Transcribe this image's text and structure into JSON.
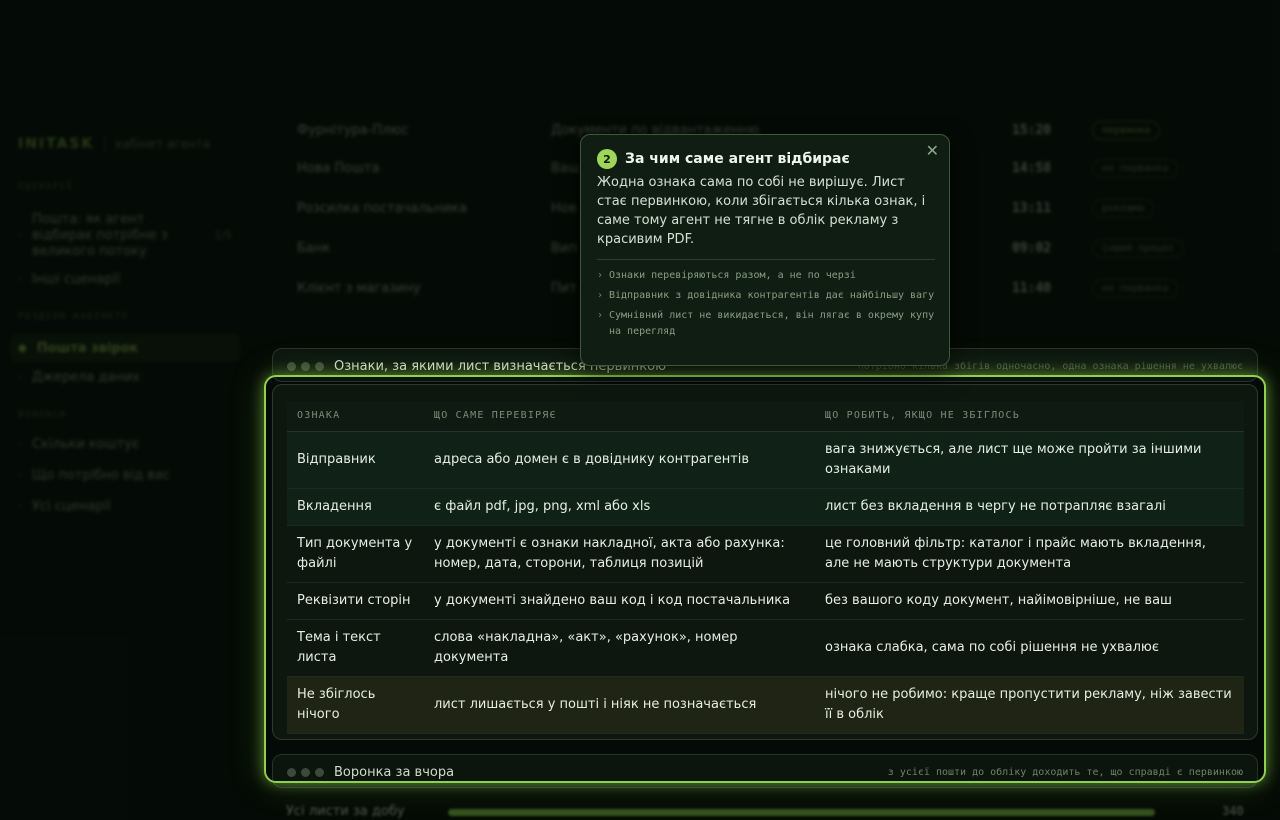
{
  "sidebar": {
    "brand": "INITASK",
    "brand_sub": "кабінет агента",
    "sections": [
      {
        "title": "СЦЕНАРІЇ",
        "items": [
          {
            "label": "Пошта: як агент відбирає потрібне з великого потоку",
            "count": "1/5"
          },
          {
            "label": "Інші сценарії",
            "count": ""
          }
        ]
      },
      {
        "title": "РОЗДІЛИ КАБІНЕТУ",
        "items": [
          {
            "label": "Пошта звірок",
            "count": ""
          },
          {
            "label": "Джерела даних",
            "count": ""
          }
        ]
      },
      {
        "title": "ФІНАНСИ",
        "items": [
          {
            "label": "Скільки коштує",
            "count": ""
          },
          {
            "label": "Що потрібно від вас",
            "count": ""
          },
          {
            "label": "Усі сценарії",
            "count": ""
          }
        ]
      }
    ]
  },
  "mail_rows": [
    {
      "from": "Фурнітура-Плюс",
      "subject": "Документи по відвантаженню",
      "time": "15:20",
      "tag": "первинка"
    },
    {
      "from": "Нова Пошта",
      "subject": "Ваш",
      "time": "14:58",
      "tag": "не первинка"
    },
    {
      "from": "Розсилка постачальника",
      "subject": "Нов",
      "time": "13:11",
      "tag": "реклама"
    },
    {
      "from": "Банк",
      "subject": "Вип",
      "time": "09:02",
      "tag": "інший процес"
    },
    {
      "from": "Клієнт з магазину",
      "subject": "Пит",
      "time": "11:40",
      "tag": "не первинка"
    }
  ],
  "criteria_panel": {
    "title": "Ознаки, за якими лист визначається первинкою",
    "note": "потрібно кілька збігів одночасно, одна ознака рішення не ухвалює"
  },
  "table": {
    "headers": [
      "ОЗНАКА",
      "ЩО САМЕ ПЕРЕВІРЯЄ",
      "ЩО РОБИТЬ, ЯКЩО НЕ ЗБІГЛОСЬ"
    ],
    "rows": [
      [
        "Відправник",
        "адреса або домен є в довіднику контрагентів",
        "вага знижується, але лист ще може пройти за іншими ознаками"
      ],
      [
        "Вкладення",
        "є файл pdf, jpg, png, xml або xls",
        "лист без вкладення в чергу не потрапляє взагалі"
      ],
      [
        "Тип документа у файлі",
        "у документі є ознаки накладної, акта або рахунка: номер, дата, сторони, таблиця позицій",
        "це головний фільтр: каталог і прайс мають вкладення, але не мають структури документа"
      ],
      [
        "Реквізити сторін",
        "у документі знайдено ваш код і код постачальника",
        "без вашого коду документ, найімовірніше, не ваш"
      ],
      [
        "Тема і текст листа",
        "слова «накладна», «акт», «рахунок», номер документа",
        "ознака слабка, сама по собі рішення не ухвалює"
      ],
      [
        "Не збіглось нічого",
        "лист лишається у пошті і ніяк не позначається",
        "нічого не робимо: краще пропустити рекламу, ніж завести її в облік"
      ]
    ]
  },
  "funnel_panel": {
    "title": "Воронка за вчора",
    "note": "з усієї пошти до обліку доходить те, що справді є первинкою"
  },
  "progress": {
    "label": "Усі листи за добу",
    "value": "340"
  },
  "popover": {
    "step": "2",
    "title": "За чим саме агент відбирає",
    "text": "Жодна ознака сама по собі не вирішує. Лист стає первинкою, коли збігається кілька ознак, і саме тому агент не тягне в облік рекламу з красивим PDF.",
    "close": "✕",
    "points": [
      "Ознаки перевіряються разом, а не по черзі",
      "Відправник з довідника контрагентів дає найбільшу вагу",
      "Сумнівний лист не викидається, він лягає в окрему купу на перегляд"
    ]
  }
}
